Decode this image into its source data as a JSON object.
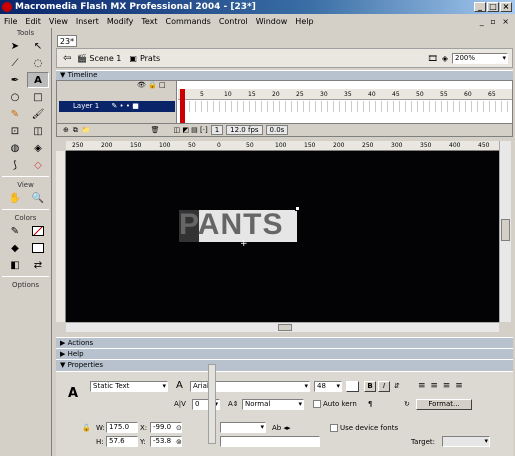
{
  "window": {
    "title": "Macromedia Flash MX Professional 2004 - [23*]",
    "controls": [
      "_",
      "□",
      "×"
    ]
  },
  "menu": [
    "File",
    "Edit",
    "View",
    "Insert",
    "Modify",
    "Text",
    "Commands",
    "Control",
    "Window",
    "Help"
  ],
  "tools": {
    "header": "Tools",
    "view_header": "View",
    "colors_header": "Colors",
    "options_header": "Options",
    "items": [
      "arrow-tool",
      "subselect-tool",
      "line-tool",
      "lasso-tool",
      "pen-tool",
      "text-tool",
      "oval-tool",
      "rectangle-tool",
      "pencil-tool",
      "brush-tool",
      "free-transform-tool",
      "fill-transform-tool",
      "ink-bottle-tool",
      "paint-bucket-tool",
      "eyedropper-tool",
      "eraser-tool"
    ]
  },
  "document": {
    "tab": "23*",
    "scene": "Scene 1",
    "symbol": "Prats",
    "zoom": "200%"
  },
  "timeline": {
    "header": "Timeline",
    "layer_name": "Layer 1",
    "frame_ticks": [
      "5",
      "10",
      "15",
      "20",
      "25",
      "30",
      "35",
      "40",
      "45",
      "50",
      "55",
      "60",
      "65"
    ],
    "current_frame": "1",
    "fps": "12.0 fps",
    "elapsed": "0.0s"
  },
  "stage": {
    "text": "PANTS",
    "ruler_ticks": [
      "250",
      "200",
      "150",
      "100",
      "50",
      "0",
      "50",
      "100",
      "150",
      "200",
      "250",
      "300",
      "350",
      "400",
      "450"
    ]
  },
  "panels": {
    "actions": "Actions",
    "help": "Help",
    "properties": "Properties"
  },
  "properties": {
    "text_type": "Static Text",
    "font": "Arial",
    "font_size": "48",
    "spacing": "0",
    "position_mode": "Normal",
    "auto_kern": "Auto kern",
    "format_button": "Format...",
    "w_label": "W:",
    "w_value": "175.0",
    "x_label": "X:",
    "x_value": "-99.0",
    "h_label": "H:",
    "h_value": "57.6",
    "y_label": "Y:",
    "y_value": "-53.8",
    "device_fonts": "Use device fonts",
    "target_label": "Target:"
  }
}
